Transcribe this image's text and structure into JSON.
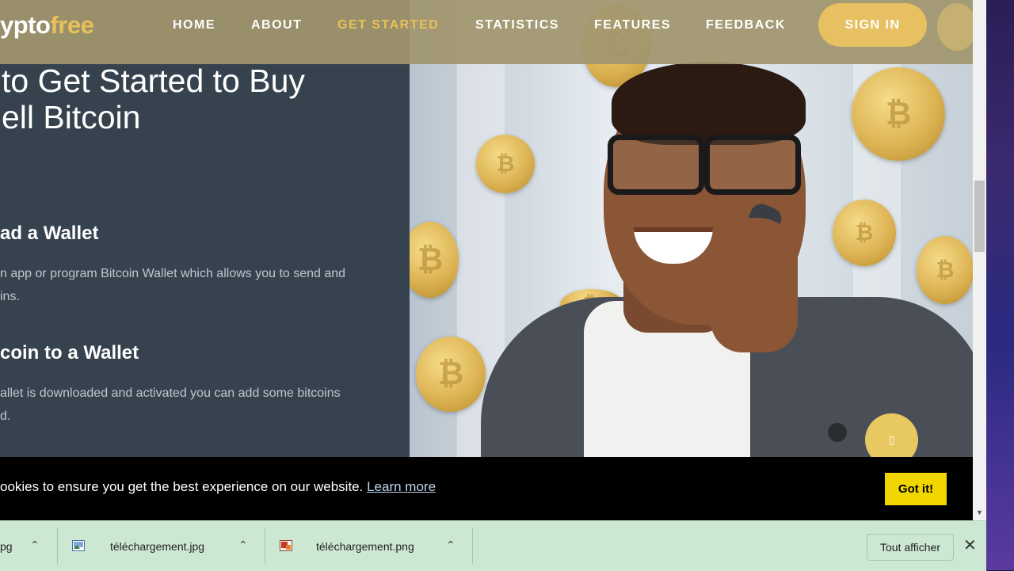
{
  "header": {
    "logo_part1": "ypto",
    "logo_part2": "free",
    "nav": [
      {
        "label": "HOME",
        "active": false
      },
      {
        "label": "ABOUT",
        "active": false
      },
      {
        "label": "GET STARTED",
        "active": true
      },
      {
        "label": "STATISTICS",
        "active": false
      },
      {
        "label": "FEATURES",
        "active": false
      },
      {
        "label": "FEEDBACK",
        "active": false
      }
    ],
    "signin_label": "SIGN IN"
  },
  "content": {
    "heading_line1": "to Get Started to Buy",
    "heading_line2": "ell Bitcoin",
    "steps": [
      {
        "title": "ad a Wallet",
        "text_line1": "n app or program Bitcoin Wallet which allows you to send and",
        "text_line2": "ins."
      },
      {
        "title": "coin to a Wallet",
        "text_line1": "allet is downloaded and activated you can add some bitcoins",
        "text_line2": "d."
      }
    ]
  },
  "scroll_top_glyph": "▯",
  "cookie_bar": {
    "text": "ookies to ensure you get the best experience on our website.",
    "learn_more": "Learn more",
    "accept_label": "Got it!"
  },
  "downloads": {
    "items": [
      {
        "name": "pg",
        "icon": "file-partial-icon"
      },
      {
        "name": "téléchargement.jpg",
        "icon": "image-file-icon"
      },
      {
        "name": "téléchargement.png",
        "icon": "png-file-icon"
      }
    ],
    "show_all_label": "Tout afficher"
  },
  "theme": {
    "accent": "#e8c15a",
    "panel_dark": "#36434f",
    "cookie_button": "#f1d600",
    "shelf_bg": "#cce8d2"
  }
}
